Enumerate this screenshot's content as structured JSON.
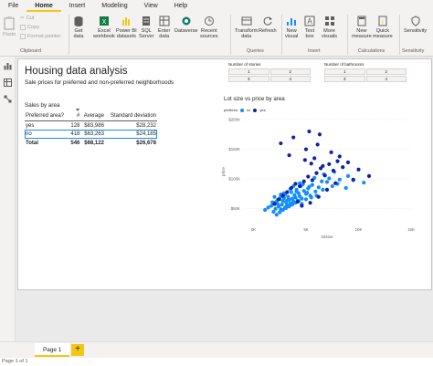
{
  "menu": {
    "tabs": [
      "File",
      "Home",
      "Insert",
      "Modeling",
      "View",
      "Help"
    ],
    "active": "Home"
  },
  "ribbon": {
    "clipboard": {
      "paste": "Paste",
      "cut": "Cut",
      "copy": "Copy",
      "format_painter": "Format painter",
      "group": "Clipboard"
    },
    "data": {
      "get_data": "Get\ndata",
      "excel": "Excel\nworkbook",
      "pbi": "Power BI\ndatasets",
      "sql": "SQL\nServer",
      "enter": "Enter\ndata",
      "dataverse": "Dataverse",
      "recent": "Recent\nsources"
    },
    "queries": {
      "transform": "Transform\ndata",
      "refresh": "Refresh",
      "group": "Queries"
    },
    "insert": {
      "new_visual": "New\nvisual",
      "text_box": "Text\nbox",
      "more_visuals": "More\nvisuals",
      "group": "Insert"
    },
    "calculations": {
      "new_measure": "New\nmeasure",
      "quick_measure": "Quick\nmeasure",
      "group": "Calculations"
    },
    "sensitivity": {
      "label": "Sensitivity",
      "group": "Sensitivity"
    }
  },
  "report": {
    "title": "Housing data analysis",
    "subtitle": "Sale prices for preferred and non-preferred neighborhoods"
  },
  "table_visual": {
    "title": "Sales by area",
    "headers": [
      "Preferred area?",
      "#",
      "Average",
      "Standard deviation"
    ],
    "rows": [
      [
        "yes",
        "128",
        "$83,986",
        "$28,232"
      ],
      [
        "no",
        "418",
        "$63,263",
        "$24,185"
      ]
    ],
    "total": [
      "Total",
      "546",
      "$68,122",
      "$26,678"
    ]
  },
  "slicers": [
    {
      "title": "Number of stories",
      "options": [
        "1",
        "2",
        "3",
        "4"
      ]
    },
    {
      "title": "Number of bathrooms",
      "options": [
        "1",
        "2",
        "3",
        "4"
      ]
    }
  ],
  "chart_data": {
    "type": "scatter",
    "title": "Lot size vs price by area",
    "xlabel": "lotsize",
    "ylabel": "price",
    "xticks": [
      "0K",
      "5K",
      "10K",
      "15K"
    ],
    "yticks": [
      "$200K",
      "$150K",
      "$100K",
      "$50K"
    ],
    "xlim": [
      0,
      16000
    ],
    "ylim": [
      25000,
      200000
    ],
    "legend_title": "preferea",
    "series": [
      {
        "name": "no",
        "color": "#118dff",
        "x": [
          2100,
          2400,
          2700,
          2900,
          3000,
          3100,
          3200,
          3300,
          3400,
          3500,
          3600,
          3600,
          3700,
          3800,
          3900,
          4000,
          4000,
          4100,
          4200,
          4300,
          4400,
          4500,
          4600,
          4700,
          4800,
          4900,
          5000,
          5100,
          5200,
          5300,
          5400,
          5500,
          5600,
          5800,
          6000,
          6200,
          6400,
          6600,
          6900,
          7200,
          7600,
          8000,
          8500,
          9000,
          9800,
          10500,
          11500,
          3200,
          3500,
          3800,
          4100,
          4400,
          4700,
          5000,
          5300,
          5600,
          6000,
          6500,
          7000,
          2800,
          3300,
          3900,
          4500,
          5100,
          5700,
          6300,
          7500,
          8200,
          9200,
          10000,
          3000,
          3600,
          4200,
          4800,
          5400,
          6100,
          6800,
          7700,
          8700
        ],
        "y": [
          48000,
          52000,
          55000,
          45000,
          60000,
          50000,
          62000,
          58000,
          54000,
          66000,
          49000,
          71000,
          57000,
          63000,
          68000,
          52000,
          74000,
          61000,
          56000,
          70000,
          65000,
          59000,
          78000,
          67000,
          62000,
          73000,
          69000,
          82000,
          64000,
          76000,
          71000,
          88000,
          67000,
          80000,
          75000,
          84000,
          72000,
          90000,
          79000,
          86000,
          82000,
          95000,
          88000,
          92000,
          85000,
          98000,
          94000,
          40000,
          44000,
          48000,
          51000,
          54000,
          57000,
          60000,
          63000,
          58000,
          66000,
          69000,
          72000,
          61000,
          65000,
          76000,
          83000,
          79000,
          91000,
          87000,
          96000,
          101000,
          99000,
          105000,
          70000,
          74000,
          64000,
          88000,
          93000,
          77000,
          102000,
          108000,
          112000
        ]
      },
      {
        "name": "yes",
        "color": "#12239e",
        "x": [
          3000,
          3400,
          3800,
          4200,
          4600,
          5000,
          5400,
          5800,
          6200,
          6600,
          7000,
          7400,
          7800,
          8200,
          8600,
          9000,
          9500,
          10000,
          4400,
          5200,
          6000,
          6800,
          7600,
          8400,
          9200,
          3600,
          4800,
          5600,
          6400,
          7200,
          8000,
          8800,
          10500,
          11000,
          12000,
          5900,
          6500,
          7100,
          6300,
          7300
        ],
        "y": [
          58000,
          66000,
          72000,
          78000,
          85000,
          92000,
          88000,
          96000,
          104000,
          98000,
          110000,
          118000,
          106000,
          125000,
          114000,
          130000,
          120000,
          128000,
          140000,
          62000,
          150000,
          135000,
          122000,
          145000,
          138000,
          160000,
          170000,
          55000,
          60000,
          70000,
          82000,
          93000,
          99000,
          116000,
          105000,
          132000,
          126000,
          158000,
          180000,
          175000
        ]
      }
    ]
  },
  "tabs": {
    "page": "Page 1",
    "add": "+"
  },
  "status": "Page 1 of 1"
}
